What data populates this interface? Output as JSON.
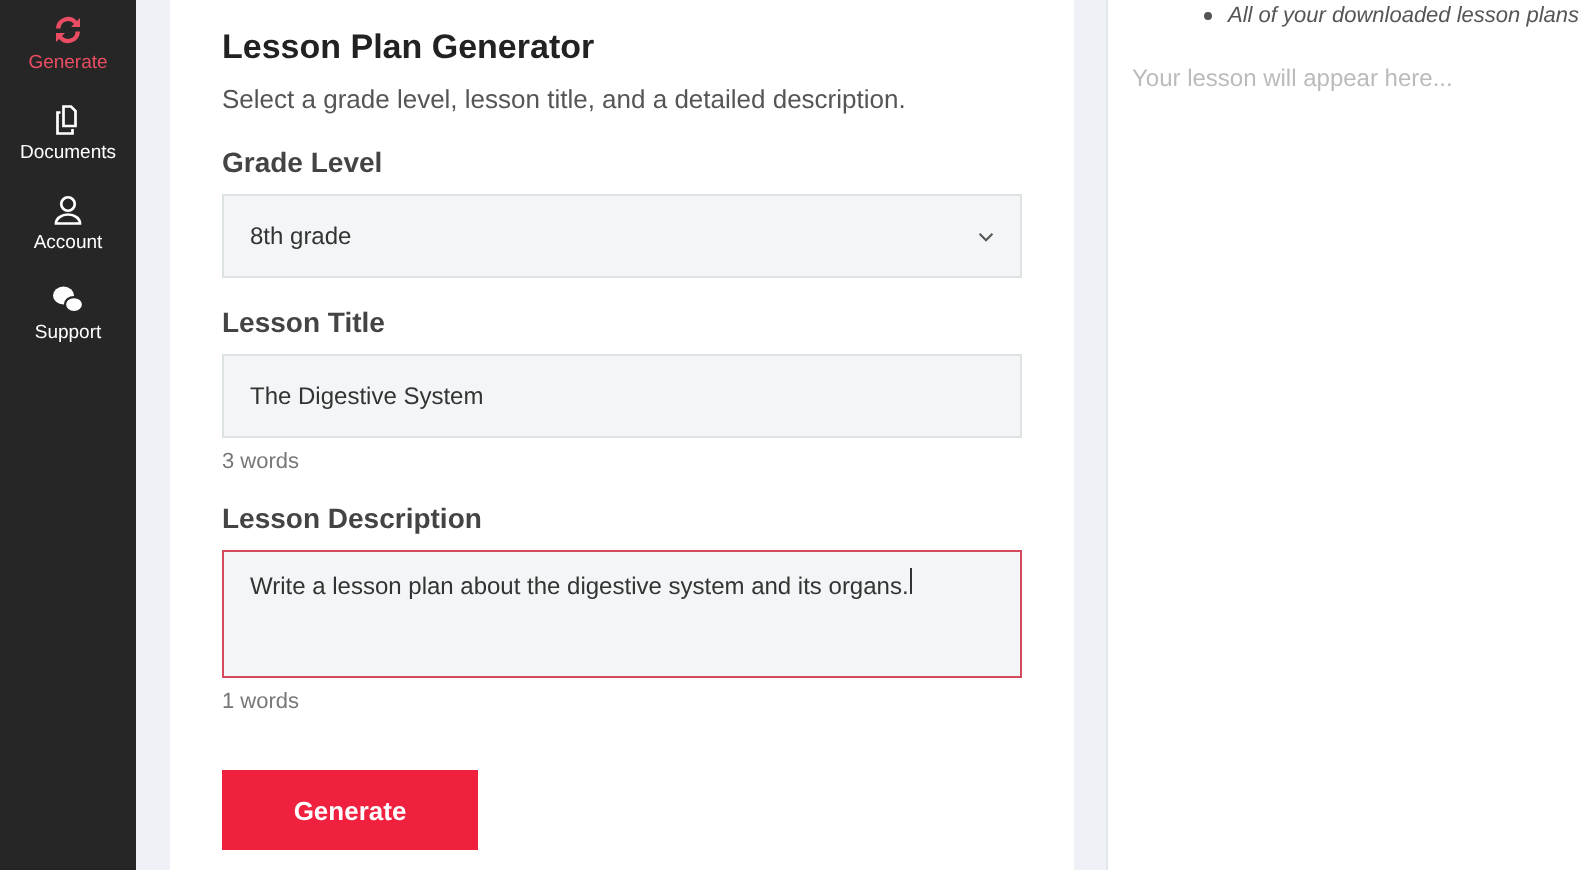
{
  "sidebar": {
    "items": [
      {
        "label": "Generate",
        "selected": true
      },
      {
        "label": "Documents",
        "selected": false
      },
      {
        "label": "Account",
        "selected": false
      },
      {
        "label": "Support",
        "selected": false
      }
    ]
  },
  "form": {
    "title": "Lesson Plan Generator",
    "subtitle": "Select a grade level, lesson title, and a detailed description.",
    "fields": [
      {
        "kind": "select",
        "label": "Grade Level",
        "value": "8th grade"
      },
      {
        "kind": "text",
        "label": "Lesson Title",
        "value": "The Digestive System",
        "hint": "3 words",
        "focused": false
      },
      {
        "kind": "textarea",
        "label": "Lesson Description",
        "value": "Write a lesson plan about the digestive system and its organs.",
        "hint": "1 words",
        "focused": true
      }
    ],
    "button": "Generate"
  },
  "output": {
    "note": "All of your downloaded lesson plans",
    "placeholder": "Your lesson will appear here..."
  }
}
